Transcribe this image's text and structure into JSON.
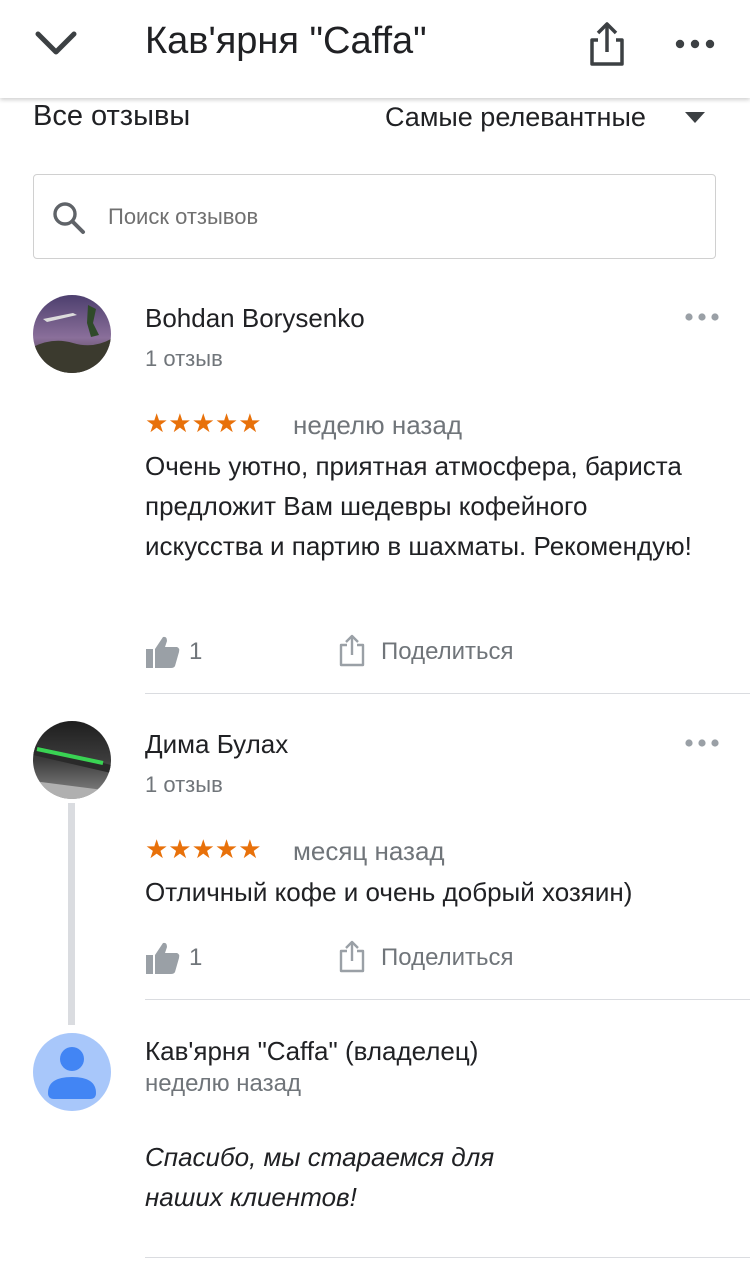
{
  "header": {
    "title": "Кав'ярня \"Caffa\"",
    "icons": {
      "back": "chevron-down-icon",
      "share": "share-icon",
      "more": "more-horizontal-icon"
    }
  },
  "toolbar": {
    "all_reviews_label": "Все отзывы",
    "sort_label": "Самые релевантные"
  },
  "search": {
    "placeholder": "Поиск отзывов",
    "value": ""
  },
  "colors": {
    "star": "#e8710a",
    "secondary_text": "#70757a",
    "divider": "#dadce0"
  },
  "reviews": [
    {
      "author": "Bohdan Borysenko",
      "count": "1 отзыв",
      "stars": "★★★★★",
      "rating": 5,
      "date": "неделю назад",
      "text": "Очень уютно, приятная атмосфера, бариста предложит Вам шедевры кофейного искусства и партию в шахматы. Рекомендую!",
      "likes": "1",
      "share_label": "Поделиться"
    },
    {
      "author": "Дима Булах",
      "count": "1 отзыв",
      "stars": "★★★★★",
      "rating": 5,
      "date": "месяц назад",
      "text": "Отличный кофе и очень добрый хозяин)",
      "likes": "1",
      "share_label": "Поделиться"
    }
  ],
  "owner_reply": {
    "author": "Кав'ярня \"Caffa\" (владелец)",
    "date": "неделю назад",
    "text": "Спасибо, мы стараемся для наших клиентов!"
  }
}
